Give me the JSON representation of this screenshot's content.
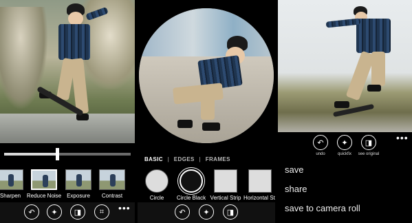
{
  "screen_edit": {
    "slider_value": 0.42,
    "filters": [
      {
        "label": "Sharpen",
        "selected": false
      },
      {
        "label": "Reduce Noise",
        "selected": true
      },
      {
        "label": "Exposure",
        "selected": false
      },
      {
        "label": "Contrast",
        "selected": false
      }
    ],
    "appbar_icons": [
      "undo-icon",
      "quickfix-icon",
      "compare-icon",
      "crop-icon"
    ],
    "more": "•••"
  },
  "screen_frames": {
    "tabs": {
      "basic": "BASIC",
      "edges": "EDGES",
      "frames": "FRAMES",
      "separator": "|"
    },
    "frames": [
      {
        "label": "Circle",
        "selected": false
      },
      {
        "label": "Circle Black",
        "selected": true
      },
      {
        "label": "Vertical Strip",
        "selected": false
      },
      {
        "label": "Horizontal Strip",
        "selected": false
      }
    ],
    "appbar_icons": [
      "undo-icon",
      "quickfix-icon",
      "compare-icon"
    ]
  },
  "screen_save": {
    "actions": [
      {
        "icon": "undo-icon",
        "label": "undo"
      },
      {
        "icon": "quickfix-icon",
        "label": "quickfix"
      },
      {
        "icon": "compare-icon",
        "label": "see original"
      }
    ],
    "more": "•••",
    "menu": [
      "save",
      "share",
      "save to camera roll"
    ]
  },
  "colors": {
    "accent": "#ffffff",
    "appbar": "#111111",
    "background": "#000000"
  }
}
